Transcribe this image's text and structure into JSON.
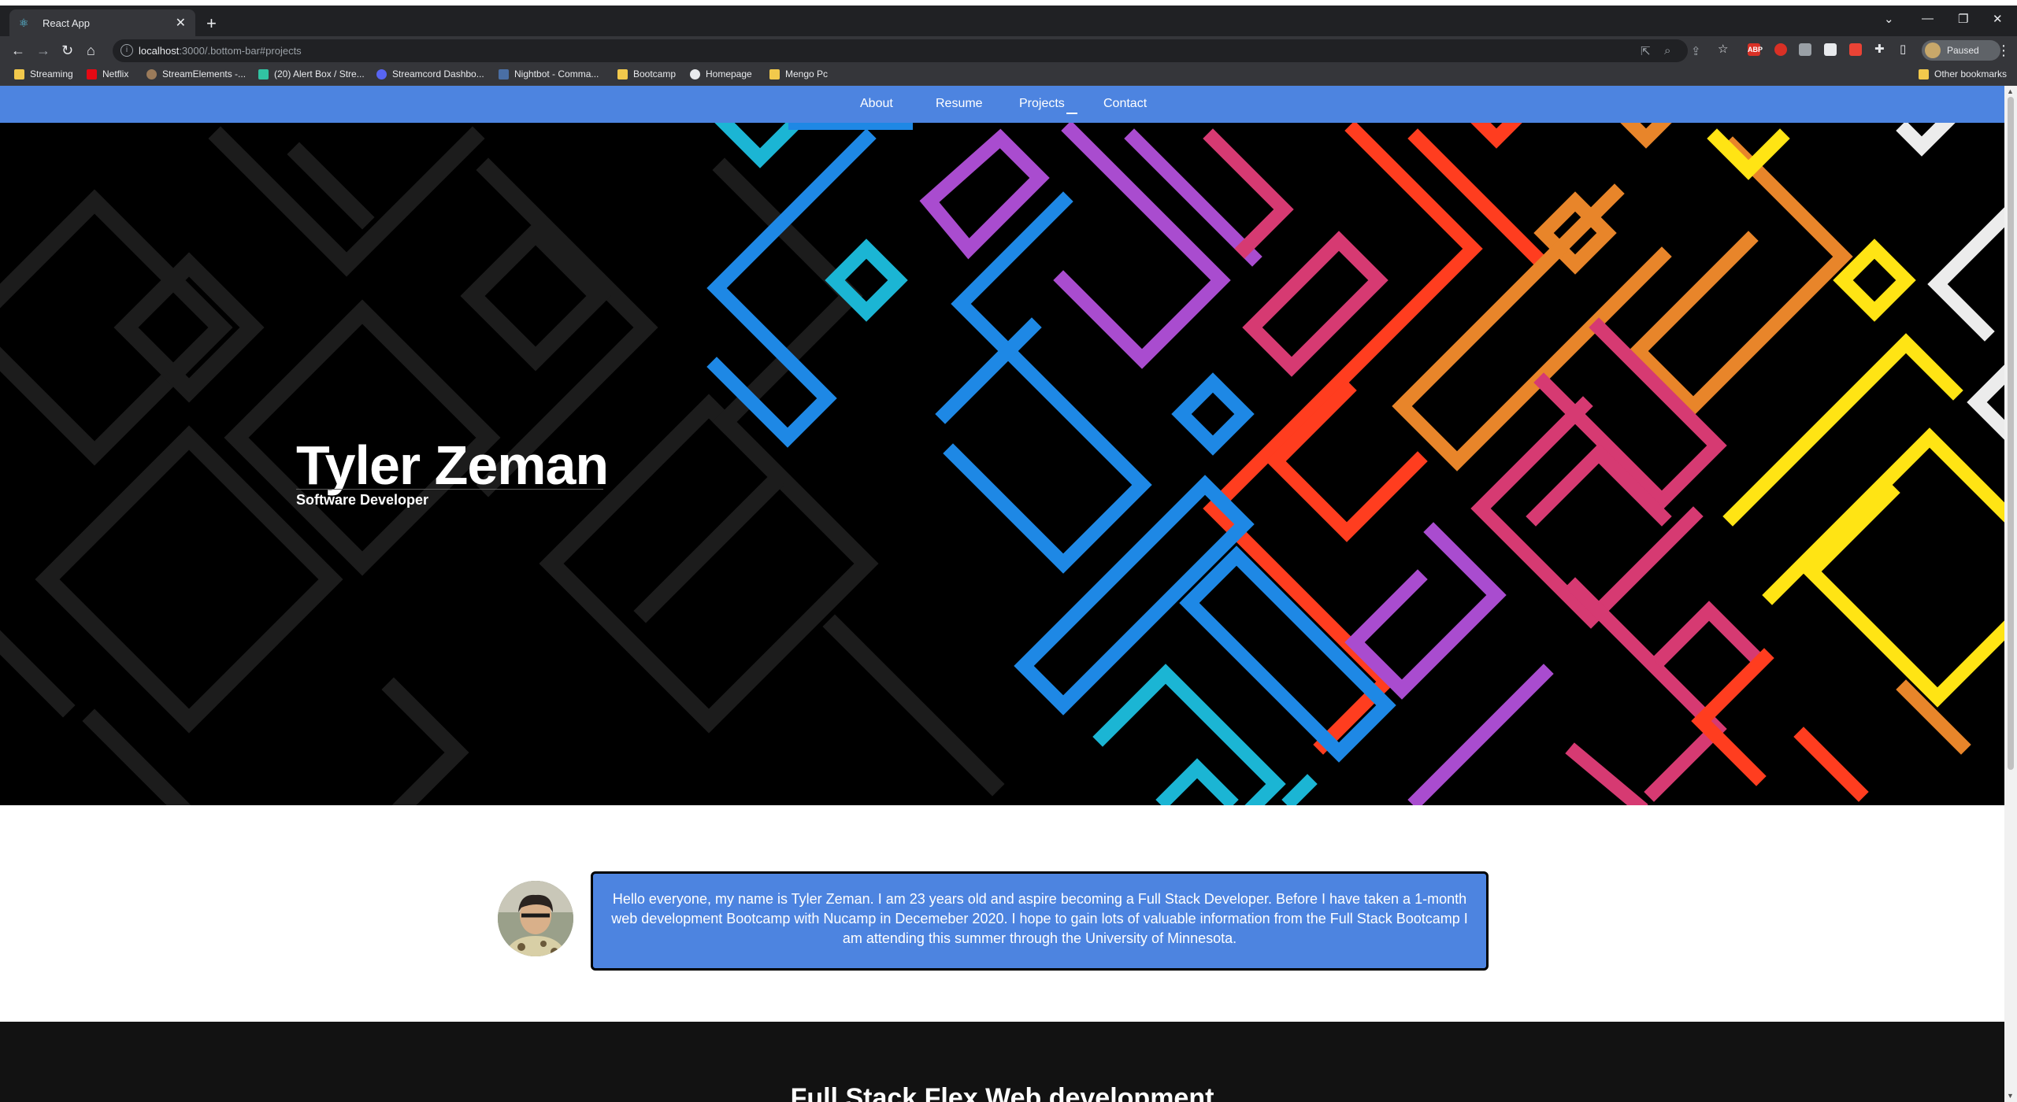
{
  "browser": {
    "tab_title": "React App",
    "url_host": "localhost",
    "url_rest": ":3000/.bottom-bar#projects",
    "profile_label": "Paused",
    "extension_labels": [
      "ABP"
    ],
    "bookmarks": [
      {
        "label": "Streaming",
        "icon": "folder-icon"
      },
      {
        "label": "Netflix",
        "icon": "netflix-icon"
      },
      {
        "label": "StreamElements -...",
        "icon": "streamelements-icon"
      },
      {
        "label": "(20) Alert Box / Stre...",
        "icon": "alertbox-icon"
      },
      {
        "label": "Streamcord Dashbo...",
        "icon": "discord-icon"
      },
      {
        "label": "Nightbot - Comma...",
        "icon": "nightbot-icon"
      },
      {
        "label": "Bootcamp",
        "icon": "folder-icon"
      },
      {
        "label": "Homepage",
        "icon": "globe-icon"
      },
      {
        "label": "Mengo Pc",
        "icon": "folder-icon"
      }
    ],
    "other_bookmarks": "Other bookmarks"
  },
  "site": {
    "nav": [
      "About",
      "Resume",
      "Projects",
      "Contact"
    ],
    "hero": {
      "name": "Tyler Zeman",
      "subtitle": "Software Developer"
    },
    "about": {
      "bio": "Hello everyone, my name is Tyler Zeman. I am 23 years old and aspire becoming a Full Stack Developer. Before I have taken a 1-month web development Bootcamp with Nucamp in Decemeber 2020. I hope to gain lots of valuable information from the Full Stack Bootcamp I am attending this summer through the University of Minnesota."
    },
    "projects": {
      "heading": "Full Stack Flex Web development"
    }
  },
  "colors": {
    "nav_bg": "#4d84e0",
    "hero_bg": "#000000",
    "pattern_dark": "#1c1c1c",
    "maze_colors": [
      "#1e88e5",
      "#1bb5d4",
      "#a94ccf",
      "#d63a72",
      "#ff3d1f",
      "#e8852a",
      "#ffe414",
      "#ececec"
    ]
  }
}
